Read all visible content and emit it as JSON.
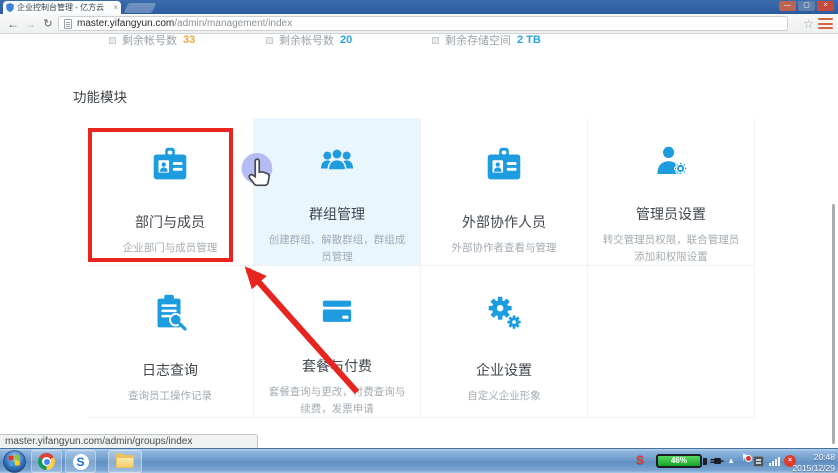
{
  "browser": {
    "tab_title": "企业控制台管理 - 亿方云",
    "url_domain": "master.yifangyun.com",
    "url_path": "/admin/management/index",
    "status_link": "master.yifangyun.com/admin/groups/index"
  },
  "icons": {
    "back": "←",
    "forward": "→",
    "reload": "↻",
    "star": "☆",
    "window_min": "—",
    "window_max": "▢",
    "window_close": "×",
    "tab_close": "×",
    "tray_caret": "▲",
    "tray_flag": "⚑",
    "mute_x": "×",
    "sogou_s_blue": "S",
    "sogou_s_red": "S"
  },
  "page": {
    "section_title": "功能模块",
    "stats": [
      {
        "label": "剩余帐号数",
        "value": "33"
      },
      {
        "label": "剩余帐号数",
        "value": "20"
      },
      {
        "label": "剩余存储空间",
        "value": "2 TB"
      }
    ],
    "modules": [
      {
        "title": "部门与成员",
        "desc": "企业部门与成员管理",
        "icon": "id-badge"
      },
      {
        "title": "群组管理",
        "desc": "创建群组、解散群组，群组成员管理",
        "icon": "people-group"
      },
      {
        "title": "外部协作人员",
        "desc": "外部协作者查看与管理",
        "icon": "id-badge"
      },
      {
        "title": "管理员设置",
        "desc": "转交管理员权限，联合管理员添加和权限设置",
        "icon": "person-gear"
      },
      {
        "title": "日志查询",
        "desc": "查询员工操作记录",
        "icon": "log-search"
      },
      {
        "title": "套餐与付费",
        "desc": "套餐查询与更改，付费查询与续费，发票申请",
        "icon": "credit-card"
      },
      {
        "title": "企业设置",
        "desc": "自定义企业形象",
        "icon": "gears"
      }
    ]
  },
  "taskbar": {
    "battery_percent": "46%",
    "time": "20:48",
    "date": "2015/12/29"
  },
  "colors": {
    "accent_blue": "#1e9ce0",
    "highlight_red": "#e8251f",
    "stat_orange": "#f0a33c",
    "stat_blue": "#29a3dd",
    "hover_card_bg": "#e9f6fd",
    "tabstrip_blue": "#2c5c9f"
  }
}
